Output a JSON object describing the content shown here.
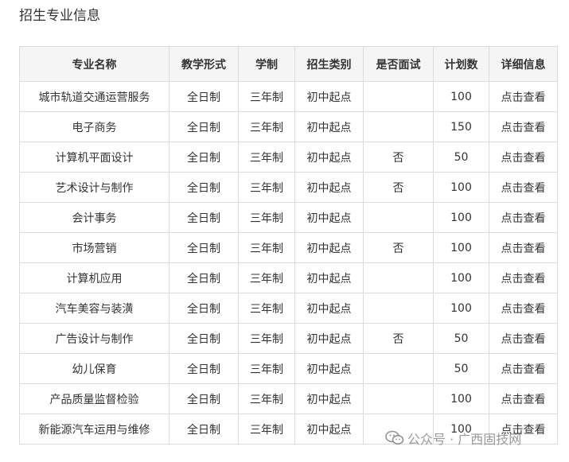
{
  "page": {
    "title": "招生专业信息"
  },
  "table": {
    "headers": [
      "专业名称",
      "教学形式",
      "学制",
      "招生类别",
      "是否面试",
      "计划数",
      "详细信息"
    ],
    "rows": [
      [
        "城市轨道交通运营服务",
        "全日制",
        "三年制",
        "初中起点",
        "",
        "100",
        "点击查看"
      ],
      [
        "电子商务",
        "全日制",
        "三年制",
        "初中起点",
        "",
        "150",
        "点击查看"
      ],
      [
        "计算机平面设计",
        "全日制",
        "三年制",
        "初中起点",
        "否",
        "50",
        "点击查看"
      ],
      [
        "艺术设计与制作",
        "全日制",
        "三年制",
        "初中起点",
        "否",
        "100",
        "点击查看"
      ],
      [
        "会计事务",
        "全日制",
        "三年制",
        "初中起点",
        "",
        "100",
        "点击查看"
      ],
      [
        "市场营销",
        "全日制",
        "三年制",
        "初中起点",
        "否",
        "100",
        "点击查看"
      ],
      [
        "计算机应用",
        "全日制",
        "三年制",
        "初中起点",
        "",
        "100",
        "点击查看"
      ],
      [
        "汽车美容与装潢",
        "全日制",
        "三年制",
        "初中起点",
        "",
        "100",
        "点击查看"
      ],
      [
        "广告设计与制作",
        "全日制",
        "三年制",
        "初中起点",
        "否",
        "50",
        "点击查看"
      ],
      [
        "幼儿保育",
        "全日制",
        "三年制",
        "初中起点",
        "",
        "50",
        "点击查看"
      ],
      [
        "产品质量监督检验",
        "全日制",
        "三年制",
        "初中起点",
        "",
        "100",
        "点击查看"
      ],
      [
        "新能源汽车运用与维修",
        "全日制",
        "三年制",
        "初中起点",
        "",
        "100",
        "点击查看"
      ]
    ]
  },
  "watermark": {
    "icon": "wechat-icon",
    "text": "公众号 · 广西固技网"
  }
}
